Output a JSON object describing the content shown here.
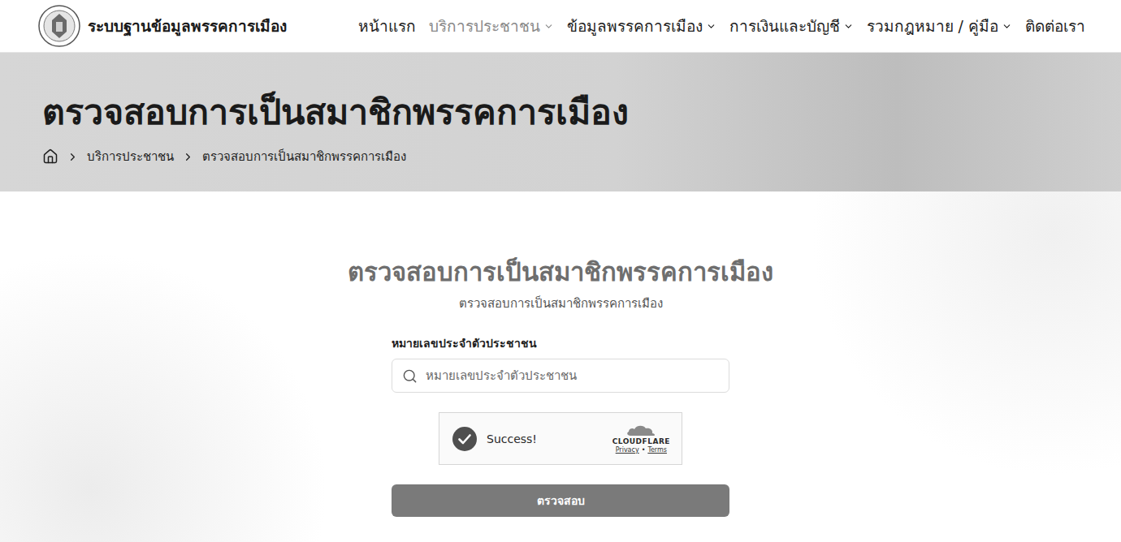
{
  "header": {
    "site_title": "ระบบฐานข้อมูลพรรคการเมือง",
    "nav": [
      {
        "label": "หน้าแรก",
        "selected": false,
        "has_dropdown": false
      },
      {
        "label": "บริการประชาชน",
        "selected": true,
        "has_dropdown": true
      },
      {
        "label": "ข้อมูลพรรคการเมือง",
        "selected": false,
        "has_dropdown": true
      },
      {
        "label": "การเงินและบัญชี",
        "selected": false,
        "has_dropdown": true
      },
      {
        "label": "รวมกฎหมาย / คู่มือ",
        "selected": false,
        "has_dropdown": true
      },
      {
        "label": "ติดต่อเรา",
        "selected": false,
        "has_dropdown": false
      }
    ]
  },
  "banner": {
    "title": "ตรวจสอบการเป็นสมาชิกพรรคการเมือง",
    "breadcrumb": [
      "บริการประชาชน",
      "ตรวจสอบการเป็นสมาชิกพรรคการเมือง"
    ]
  },
  "form": {
    "title": "ตรวจสอบการเป็นสมาชิกพรรคการเมือง",
    "subtitle": "ตรวจสอบการเป็นสมาชิกพรรคการเมือง",
    "field_label": "หมายเลขประจำตัวประชาชน",
    "placeholder": "หมายเลขประจำตัวประชาชน",
    "captcha": {
      "status": "Success!",
      "verified": true,
      "brand": "CLOUDFLARE",
      "links": [
        "Privacy",
        "Terms"
      ],
      "separator": "•"
    },
    "button": "ตรวจสอบ"
  }
}
